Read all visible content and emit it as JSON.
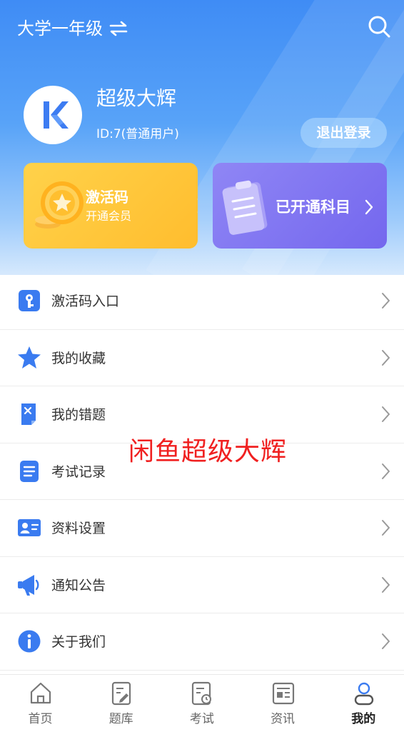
{
  "header": {
    "grade_label": "大学一年级",
    "user": {
      "name": "超级大辉",
      "id_text": "ID:7(普通用户)",
      "avatar_letter": "K"
    },
    "logout_label": "退出登录"
  },
  "cards": {
    "activation": {
      "title": "激活码",
      "subtitle": "开通会员"
    },
    "subjects": {
      "title": "已开通科目"
    }
  },
  "menu": [
    {
      "label": "激活码入口",
      "icon": "key-icon"
    },
    {
      "label": "我的收藏",
      "icon": "star-icon"
    },
    {
      "label": "我的错题",
      "icon": "wrong-question-icon"
    },
    {
      "label": "考试记录",
      "icon": "record-list-icon"
    },
    {
      "label": "资料设置",
      "icon": "id-card-icon"
    },
    {
      "label": "通知公告",
      "icon": "megaphone-icon"
    },
    {
      "label": "关于我们",
      "icon": "info-icon"
    }
  ],
  "watermark": "闲鱼超级大辉",
  "tabbar": [
    {
      "label": "首页",
      "icon": "home-icon",
      "active": false
    },
    {
      "label": "题库",
      "icon": "question-bank-icon",
      "active": false
    },
    {
      "label": "考试",
      "icon": "exam-icon",
      "active": false
    },
    {
      "label": "资讯",
      "icon": "news-icon",
      "active": false
    },
    {
      "label": "我的",
      "icon": "profile-icon",
      "active": true
    }
  ],
  "colors": {
    "primary_blue": "#3f8cf5",
    "gold_card": "#ffc534",
    "purple_card": "#7d72f0",
    "icon_blue": "#3a7bf0",
    "watermark_red": "#f02020"
  }
}
